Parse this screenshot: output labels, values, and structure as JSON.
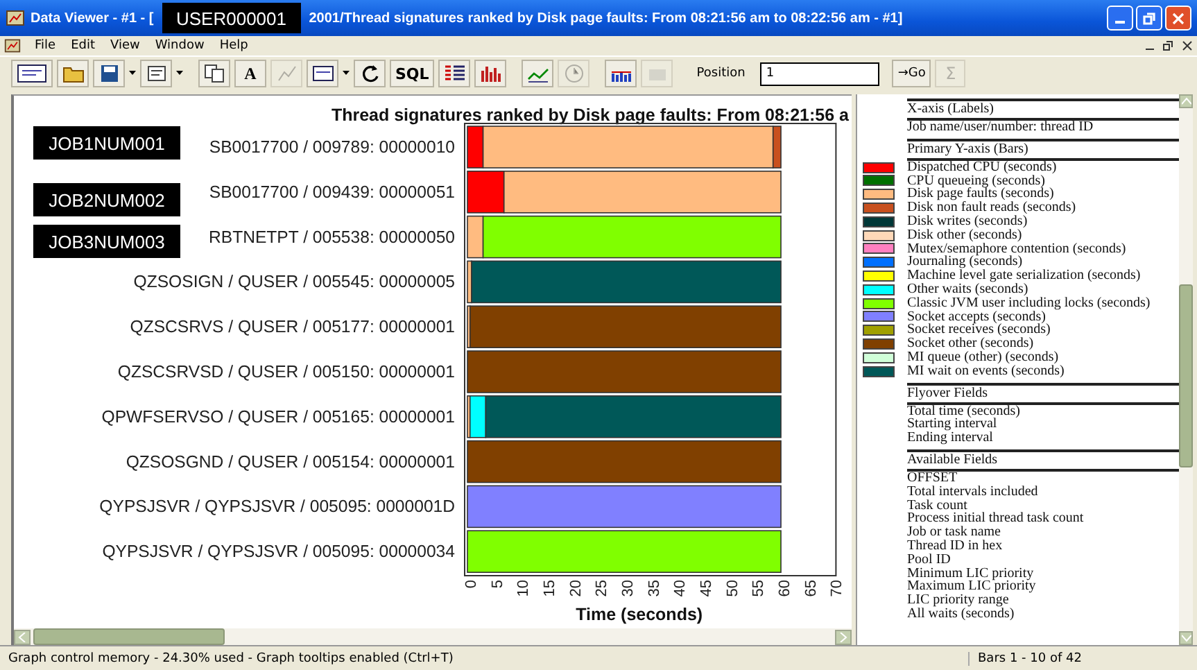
{
  "window": {
    "title_start": "Data Viewer - #1 - [",
    "title_overlay": "USER000001",
    "title_end": "2001/Thread signatures ranked by Disk page faults: From 08:21:56 am to 08:22:56 am - #1]"
  },
  "menu": [
    "File",
    "Edit",
    "View",
    "Window",
    "Help"
  ],
  "toolbar": {
    "font_label": "A",
    "sql_label": "SQL",
    "position_label": "Position",
    "position_value": "1",
    "go_label": "→Go",
    "sum_label": "Σ",
    "sum_disabled": true
  },
  "chart": {
    "overlays": [
      "JOB1NUM001",
      "JOB2NUM002",
      "JOB3NUM003"
    ],
    "chart_data": {
      "type": "bar",
      "orientation": "horizontal",
      "stacked": true,
      "title": "Thread signatures ranked by Disk page faults: From 08:21:56 a",
      "xlabel": "Time (seconds)",
      "xlim": [
        0,
        70
      ],
      "xticks": [
        0,
        5,
        10,
        15,
        20,
        25,
        30,
        35,
        40,
        45,
        50,
        55,
        60,
        65,
        70
      ],
      "categories": [
        "SB0017700 / 009789: 00000010",
        "SB0017700 / 009439: 00000051",
        "RBTNETPT / 005538: 00000050",
        "QZSOSIGN / QUSER / 005545: 00000005",
        "QZSCSRVS / QUSER / 005177: 00000001",
        "QZSCSRVSD / QUSER / 005150: 00000001",
        "QPWFSERVSO / QUSER / 005165: 00000001",
        "QZSOSGND / QUSER / 005154: 00000001",
        "QYPSJSVR / QYPSJSVR / 005095: 0000001D",
        "QYPSJSVR / QYPSJSVR / 005095: 00000034"
      ],
      "series": [
        {
          "name": "Dispatched CPU (seconds)",
          "color": "#ff0000",
          "values": [
            3,
            7,
            0,
            0,
            0,
            0,
            0,
            0,
            0,
            0
          ]
        },
        {
          "name": "CPU queueing (seconds)",
          "color": "#007000",
          "values": [
            0,
            0,
            0,
            0,
            0,
            0,
            0,
            0,
            0,
            0
          ]
        },
        {
          "name": "Disk page faults (seconds)",
          "color": "#ffbb80",
          "values": [
            55.5,
            53,
            3,
            0.8,
            0.5,
            0,
            0.5,
            0,
            0,
            0
          ]
        },
        {
          "name": "Disk non fault reads (seconds)",
          "color": "#c8501e",
          "values": [
            1.5,
            0,
            0,
            0,
            0,
            0,
            0,
            0,
            0,
            0
          ]
        },
        {
          "name": "Disk writes (seconds)",
          "color": "#003838",
          "values": [
            0,
            0,
            0,
            0,
            0,
            0,
            0,
            0,
            0,
            0
          ]
        },
        {
          "name": "Disk other (seconds)",
          "color": "#ffd8b8",
          "values": [
            0,
            0,
            0,
            0,
            0,
            0,
            0,
            0,
            0,
            0
          ]
        },
        {
          "name": "Mutex/semaphore contention (seconds)",
          "color": "#ff80c0",
          "values": [
            0,
            0,
            0,
            0,
            0,
            0,
            0,
            0,
            0,
            0
          ]
        },
        {
          "name": "Journaling (seconds)",
          "color": "#0070ff",
          "values": [
            0,
            0,
            0,
            0,
            0,
            0,
            0,
            0,
            0,
            0
          ]
        },
        {
          "name": "Machine level gate serialization (seconds)",
          "color": "#ffff00",
          "values": [
            0,
            0,
            0,
            0,
            0,
            0,
            0,
            0,
            0,
            0
          ]
        },
        {
          "name": "Other waits (seconds)",
          "color": "#00ffff",
          "values": [
            0,
            0,
            0,
            0,
            0,
            0,
            3,
            0,
            0,
            0
          ]
        },
        {
          "name": "Classic JVM user including locks (seconds)",
          "color": "#80ff00",
          "values": [
            0,
            0,
            57,
            0,
            0,
            0,
            0,
            0,
            0,
            60
          ]
        },
        {
          "name": "Socket accepts (seconds)",
          "color": "#8080ff",
          "values": [
            0,
            0,
            0,
            0,
            0,
            0,
            0,
            0,
            60,
            0
          ]
        },
        {
          "name": "Socket receives (seconds)",
          "color": "#a0a000",
          "values": [
            0,
            0,
            0,
            0,
            0,
            0,
            0,
            0,
            0,
            0
          ]
        },
        {
          "name": "Socket other (seconds)",
          "color": "#804000",
          "values": [
            0,
            0,
            0,
            0,
            59.5,
            60,
            0,
            60,
            0,
            0
          ]
        },
        {
          "name": "MI queue (other) (seconds)",
          "color": "#d0ffd8",
          "values": [
            0,
            0,
            0,
            0,
            0,
            0,
            0,
            0,
            0,
            0
          ]
        },
        {
          "name": "MI wait on events (seconds)",
          "color": "#005858",
          "values": [
            0,
            0,
            0,
            59.2,
            0,
            0,
            56.5,
            0,
            0,
            0
          ]
        }
      ]
    }
  },
  "legend": {
    "sections": [
      {
        "kind": "fields",
        "header": "X-axis (Labels)",
        "items": [
          "Job name/user/number: thread ID"
        ]
      },
      {
        "kind": "series",
        "header": "Primary Y-axis (Bars)"
      },
      {
        "kind": "fields",
        "header": "Flyover Fields",
        "items": [
          "Total time (seconds)",
          "Starting interval",
          "Ending interval"
        ]
      },
      {
        "kind": "fields",
        "header": "Available Fields",
        "items": [
          "OFFSET",
          "Total intervals included",
          "Task count",
          "Process initial thread task count",
          "Job or task name",
          "Thread ID in hex",
          "Pool ID",
          "Minimum LIC priority",
          "Maximum LIC priority",
          "LIC priority range",
          "All waits (seconds)"
        ]
      }
    ]
  },
  "status_bar": {
    "message": "Graph control memory - 24.30% used - Graph tooltips enabled (Ctrl+T)",
    "bars": "Bars 1 - 10 of 42"
  }
}
